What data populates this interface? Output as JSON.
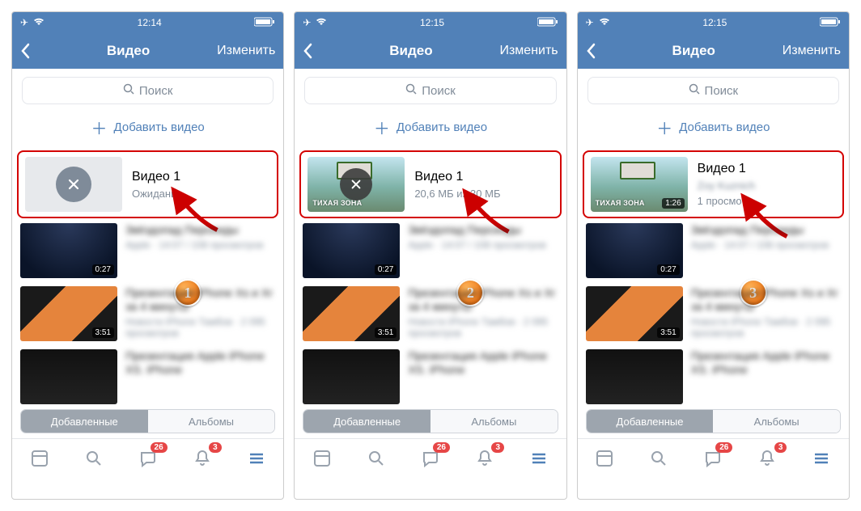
{
  "statusbar": {
    "time": [
      "12:14",
      "12:15",
      "12:15"
    ],
    "airplane_icon": "airplane",
    "wifi_icon": "wifi",
    "battery_icon": "battery"
  },
  "nav": {
    "title": "Видео",
    "edit": "Изменить"
  },
  "search": {
    "placeholder": "Поиск"
  },
  "add": {
    "label": "Добавить видео"
  },
  "hero": {
    "title": "Видео 1",
    "subs": [
      "Ожидание...",
      "20,6 МБ из 30 МБ",
      "1 просмотр"
    ],
    "zone_caption": "ТИХАЯ ЗОНА",
    "duration": "1:26"
  },
  "rows": [
    {
      "title": "Звёздопад Персеиды",
      "sub": "Apple · 14:07 / 108 просмотров",
      "dur": "0:27"
    },
    {
      "title": "Презентация iPhone Xs и Xr за 4 минуты",
      "sub": "Новости iPhone Тамбов · 2 095 просмотров",
      "dur": "3:51"
    },
    {
      "title": "Презентация Apple iPhone XS. iPhone",
      "sub": "",
      "dur": ""
    }
  ],
  "seg": {
    "added": "Добавленные",
    "albums": "Альбомы"
  },
  "badges": {
    "chat": "26",
    "bell": "3"
  },
  "steps": [
    "1",
    "2",
    "3"
  ]
}
